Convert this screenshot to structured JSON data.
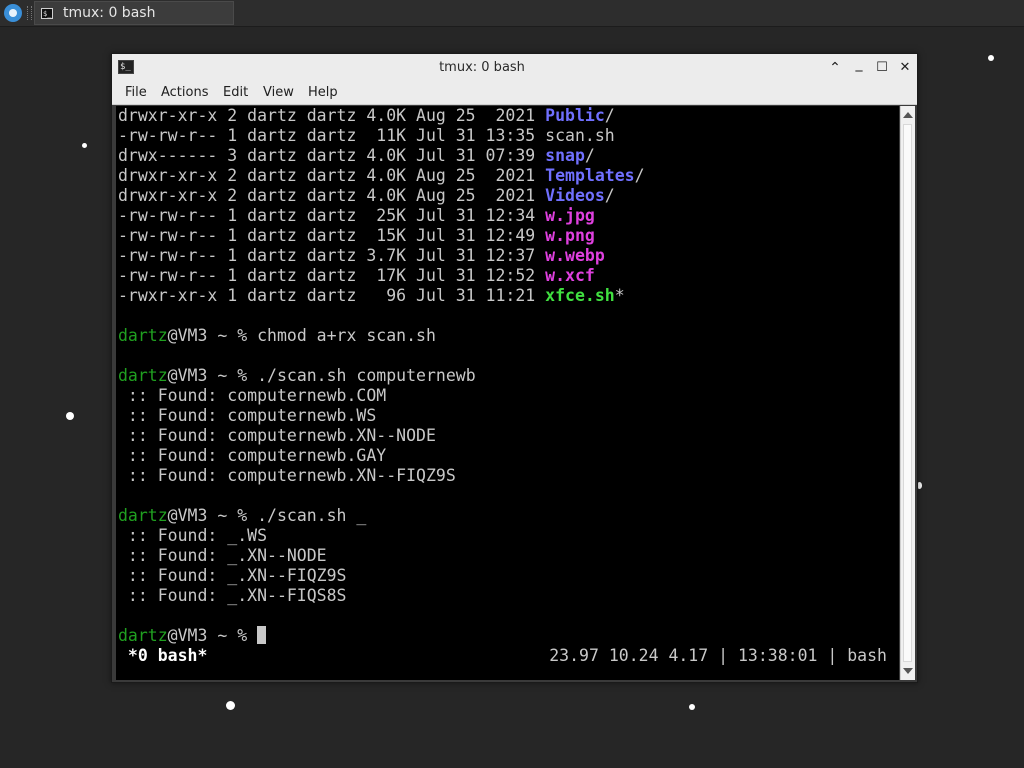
{
  "taskbar": {
    "task_title": "tmux: 0 bash",
    "start_icon": "xfce-menu-icon",
    "task_icon": "terminal-icon",
    "terminal_icon_glyph": "$_"
  },
  "window": {
    "title": "tmux: 0 bash",
    "controls": {
      "shade": "⌃",
      "minimize": "_",
      "maximize": "☐",
      "close": "✕"
    },
    "menu": [
      "File",
      "Actions",
      "Edit",
      "View",
      "Help"
    ]
  },
  "terminal": {
    "colors": {
      "bg": "#000000",
      "fg": "#c8c8c8",
      "dir": "#7070ff",
      "image": "#e040e0",
      "exec": "#40e040",
      "prompt_user": "#20a020"
    },
    "listing": [
      {
        "meta": "drwxr-xr-x 2 dartz dartz 4.0K Aug 25  2021 ",
        "name": "Public",
        "suffix": "/",
        "kind": "dir"
      },
      {
        "meta": "-rw-rw-r-- 1 dartz dartz  11K Jul 31 13:35 ",
        "name": "scan.sh",
        "suffix": "",
        "kind": "file"
      },
      {
        "meta": "drwx------ 3 dartz dartz 4.0K Jul 31 07:39 ",
        "name": "snap",
        "suffix": "/",
        "kind": "dir"
      },
      {
        "meta": "drwxr-xr-x 2 dartz dartz 4.0K Aug 25  2021 ",
        "name": "Templates",
        "suffix": "/",
        "kind": "dir"
      },
      {
        "meta": "drwxr-xr-x 2 dartz dartz 4.0K Aug 25  2021 ",
        "name": "Videos",
        "suffix": "/",
        "kind": "dir"
      },
      {
        "meta": "-rw-rw-r-- 1 dartz dartz  25K Jul 31 12:34 ",
        "name": "w.jpg",
        "suffix": "",
        "kind": "img"
      },
      {
        "meta": "-rw-rw-r-- 1 dartz dartz  15K Jul 31 12:49 ",
        "name": "w.png",
        "suffix": "",
        "kind": "img"
      },
      {
        "meta": "-rw-rw-r-- 1 dartz dartz 3.7K Jul 31 12:37 ",
        "name": "w.webp",
        "suffix": "",
        "kind": "img"
      },
      {
        "meta": "-rw-rw-r-- 1 dartz dartz  17K Jul 31 12:52 ",
        "name": "w.xcf",
        "suffix": "",
        "kind": "img"
      },
      {
        "meta": "-rwxr-xr-x 1 dartz dartz   96 Jul 31 11:21 ",
        "name": "xfce.sh",
        "suffix": "*",
        "kind": "exe"
      }
    ],
    "prompt_user": "dartz",
    "prompt_host": "@VM3 ~ % ",
    "commands": {
      "chmod": "chmod a+rx scan.sh",
      "scan1": "./scan.sh computernewb",
      "scan2": "./scan.sh _"
    },
    "scan1_results": [
      " :: Found: computernewb.COM",
      " :: Found: computernewb.WS",
      " :: Found: computernewb.XN--NODE",
      " :: Found: computernewb.GAY",
      " :: Found: computernewb.XN--FIQZ9S"
    ],
    "scan2_results": [
      " :: Found: _.WS",
      " :: Found: _.XN--NODE",
      " :: Found: _.XN--FIQZ9S",
      " :: Found: _.XN--FIQS8S"
    ],
    "status": {
      "window_tab": " *0 bash*",
      "right": "23.97 10.24 4.17 | 13:38:01 | bash"
    }
  }
}
